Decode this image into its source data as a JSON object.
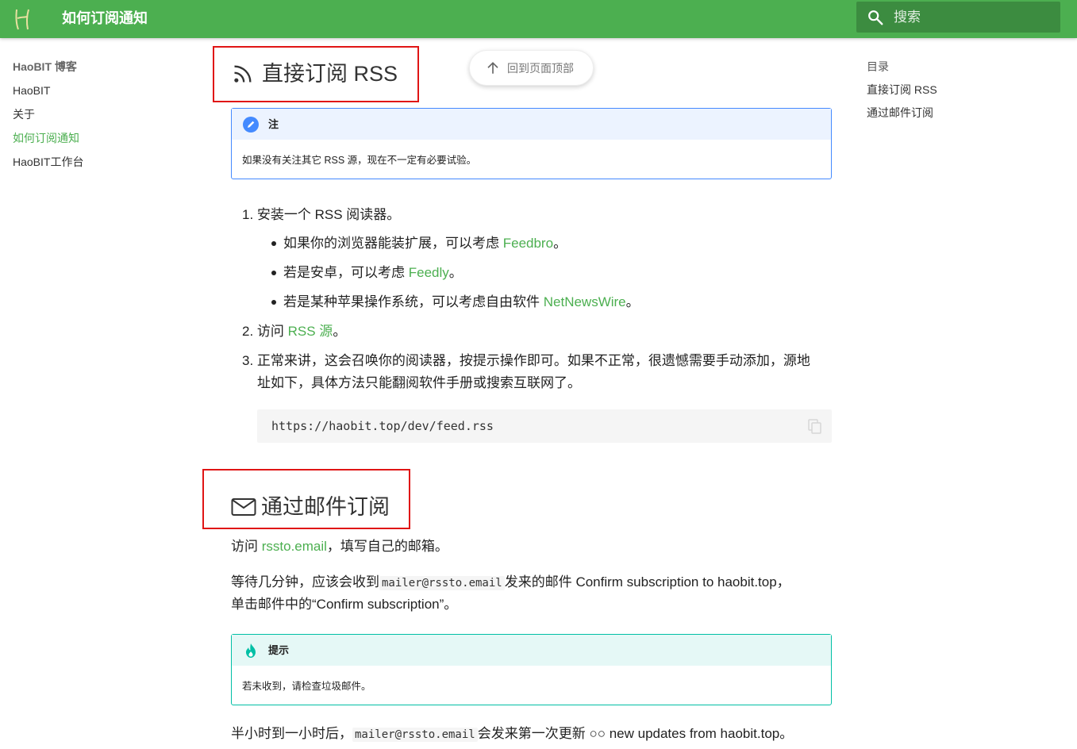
{
  "header": {
    "title": "如何订阅通知",
    "search_placeholder": "搜索",
    "colors": {
      "primary": "#4caf50"
    }
  },
  "nav": {
    "title": "HaoBIT 博客",
    "items": [
      {
        "label": "HaoBIT",
        "active": false
      },
      {
        "label": "关于",
        "active": false
      },
      {
        "label": "如何订阅通知",
        "active": true
      },
      {
        "label": "HaoBIT工作台",
        "active": false
      }
    ]
  },
  "toc": {
    "title": "目录",
    "items": [
      "直接订阅 RSS",
      "通过邮件订阅"
    ]
  },
  "back_to_top": {
    "label": "回到页面顶部"
  },
  "section1": {
    "heading": "直接订阅 RSS",
    "note": {
      "label": "注",
      "text": "如果没有关注其它 RSS 源，现在不一定有必要试验。"
    },
    "step1": "1. 安装一个 RSS 阅读器。",
    "bullets": [
      {
        "pre": "如果你的浏览器能装扩展，可以考虑 ",
        "link": "Feedbro",
        "post": "。"
      },
      {
        "pre": "若是安卓，可以考虑 ",
        "link": "Feedly",
        "post": "。"
      },
      {
        "pre": "若是某种苹果操作系统，可以考虑自由软件 ",
        "link": "NetNewsWire",
        "post": "。"
      }
    ],
    "step2": {
      "pre": "2. 访问 ",
      "link": "RSS 源",
      "post": "。"
    },
    "step3_line1": "3. 正常来讲，这会召唤你的阅读器，按提示操作即可。如果不正常，很遗憾需要手动添加，源地",
    "step3_line2": "址如下，具体方法只能翻阅软件手册或搜索互联网了。",
    "code": "https://haobit.top/dev/feed.rss"
  },
  "section2": {
    "heading": "通过邮件订阅",
    "para1": {
      "pre": "访问 ",
      "link": "rssto.email",
      "post": "，填写自己的邮箱。"
    },
    "para2_pre": "等待几分钟，应该会收到",
    "para2_code": "mailer@rssto.email",
    "para2_post": "发来的邮件 Confirm subscription to haobit.top，",
    "para2_line2": "单击邮件中的“Confirm subscription”。",
    "tip": {
      "label": "提示",
      "text": "若未收到，请检查垃圾邮件。"
    },
    "para3_pre": "半小时到一小时后，",
    "para3_code": "mailer@rssto.email",
    "para3_post": "会发来第一次更新 ○○ new updates from haobit.top。"
  }
}
